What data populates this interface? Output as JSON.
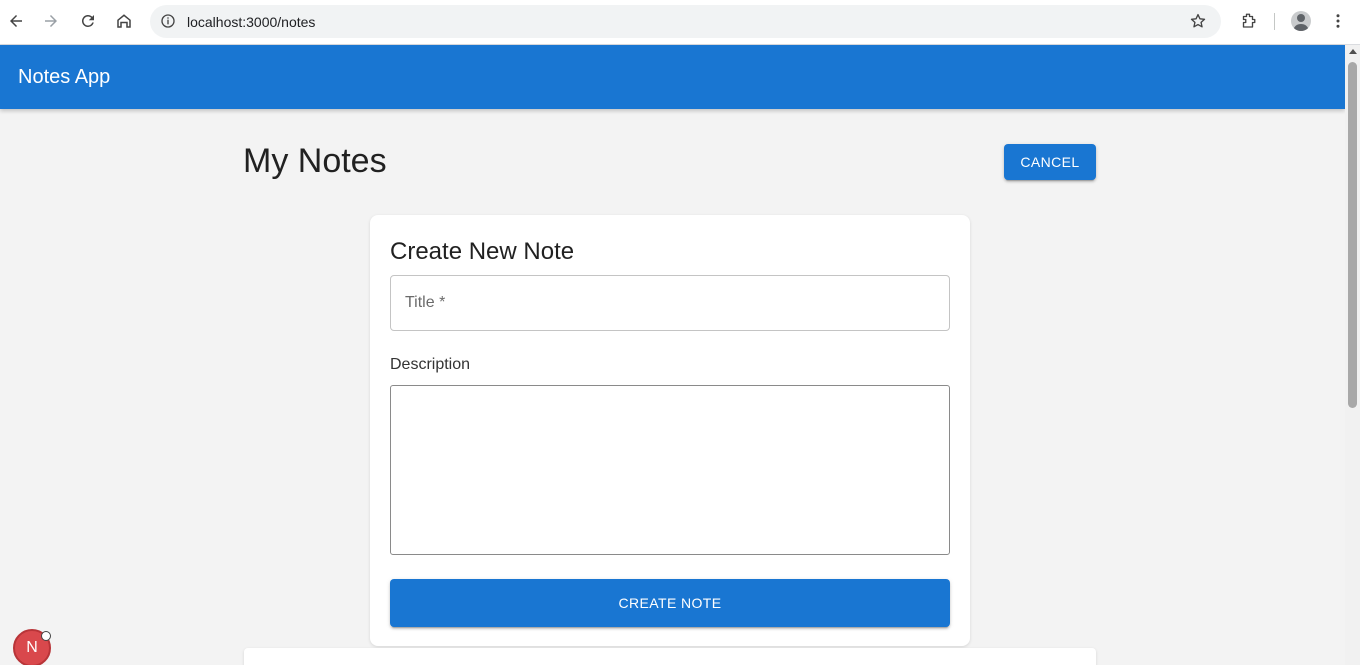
{
  "browser": {
    "url": "localhost:3000/notes",
    "icons": [
      "back-icon",
      "forward-icon",
      "reload-icon",
      "home-icon",
      "info-icon",
      "star-icon",
      "extensions-icon",
      "profile-avatar",
      "menu-icon"
    ]
  },
  "appbar": {
    "title": "Notes App",
    "color": "#1976d2"
  },
  "page": {
    "heading": "My Notes",
    "cancel_label": "CANCEL"
  },
  "form": {
    "title": "Create New Note",
    "title_placeholder": "Title *",
    "description_label": "Description",
    "description_value": "",
    "submit_label": "CREATE NOTE"
  },
  "dev_badge": {
    "label": "N"
  }
}
